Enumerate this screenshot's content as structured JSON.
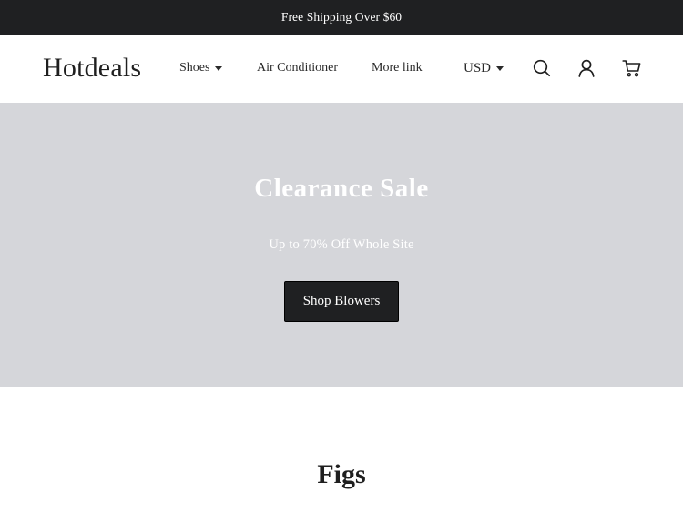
{
  "announcement": {
    "text": "Free Shipping Over $60"
  },
  "header": {
    "logo": "Hotdeals",
    "nav": {
      "shoes": "Shoes",
      "air_conditioner": "Air Conditioner",
      "more_link": "More link"
    },
    "currency": "USD",
    "icons": [
      "search-icon",
      "account-icon",
      "cart-icon"
    ]
  },
  "hero": {
    "title": "Clearance Sale",
    "subtitle": "Up to 70% Off Whole Site",
    "button_label": "Shop Blowers",
    "background_color": "#d5d6da"
  },
  "section": {
    "title": "Figs"
  },
  "colors": {
    "dark": "#1f2022",
    "text": "#1f1f1f",
    "white": "#ffffff"
  }
}
